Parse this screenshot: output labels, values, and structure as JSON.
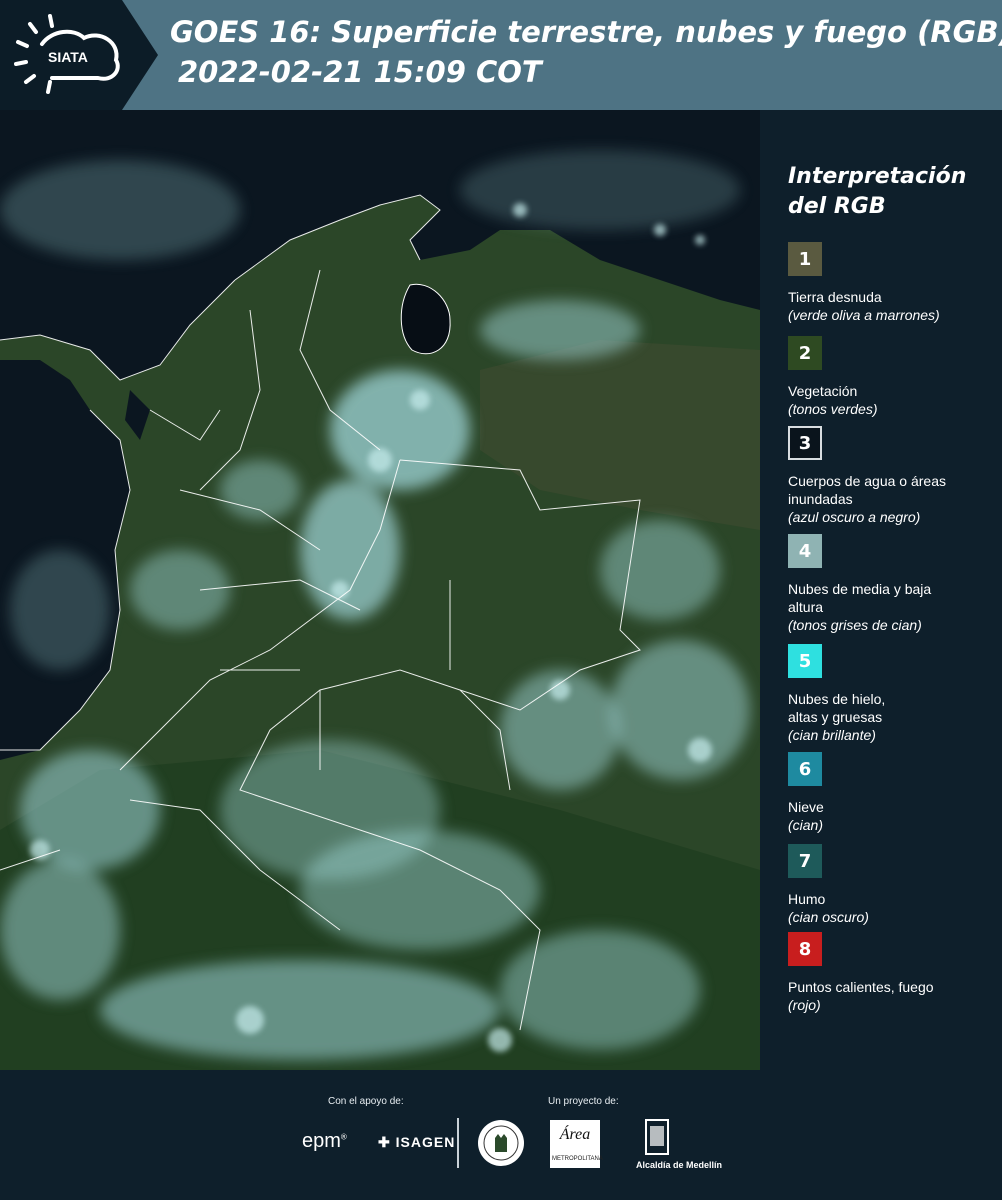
{
  "header": {
    "logo_text": "SIATA",
    "title": "GOES 16: Superficie terrestre, nubes y fuego (RGB)",
    "subtitle": "2022-02-21 15:09 COT"
  },
  "legend": {
    "title_line1": "Interpretación",
    "title_line2": "del RGB",
    "items": [
      {
        "number": "1",
        "color": "#5a5a40",
        "border": "#5a5a40",
        "label": "Tierra desnuda",
        "desc": "(verde oliva a marrones)"
      },
      {
        "number": "2",
        "color": "#2e4a22",
        "border": "#2e4a22",
        "label": "Vegetación",
        "desc": "(tonos verdes)"
      },
      {
        "number": "3",
        "color": "#0a141c",
        "border": "#d8dde0",
        "label": "Cuerpos de agua o áreas inundadas",
        "desc": "(azul oscuro a negro)"
      },
      {
        "number": "4",
        "color": "#8fb3b3",
        "border": "#8fb3b3",
        "label": "Nubes de media y baja altura",
        "desc": "(tonos grises de cian)"
      },
      {
        "number": "5",
        "color": "#2ee0e0",
        "border": "#2ee0e0",
        "label": "Nubes de hielo, altas y gruesas",
        "desc": "(cian brillante)"
      },
      {
        "number": "6",
        "color": "#1e8aa0",
        "border": "#1e8aa0",
        "label": "Nieve",
        "desc": "(cian)"
      },
      {
        "number": "7",
        "color": "#1e5a5a",
        "border": "#1e5a5a",
        "label": "Humo",
        "desc": "(cian oscuro)"
      },
      {
        "number": "8",
        "color": "#c81e1e",
        "border": "#c81e1e",
        "label": "Puntos calientes, fuego",
        "desc": "(rojo)"
      }
    ]
  },
  "footer": {
    "support_label": "Con el apoyo de:",
    "project_label": "Un proyecto de:",
    "sponsor_epm": "epm",
    "sponsor_isagen": "ISAGEN",
    "area_logo_text": "Área",
    "area_label": "METROPOLITANA",
    "medellin_label": "Alcaldía de Medellín"
  },
  "colors": {
    "header_band": "#4e7384",
    "header_dark": "#0c1c27",
    "page_bg": "#0e1f2b",
    "ocean": "#0b1620",
    "land": "#2e4a2a",
    "cloud": "#9fd6d8",
    "border_line": "#ffffff"
  }
}
